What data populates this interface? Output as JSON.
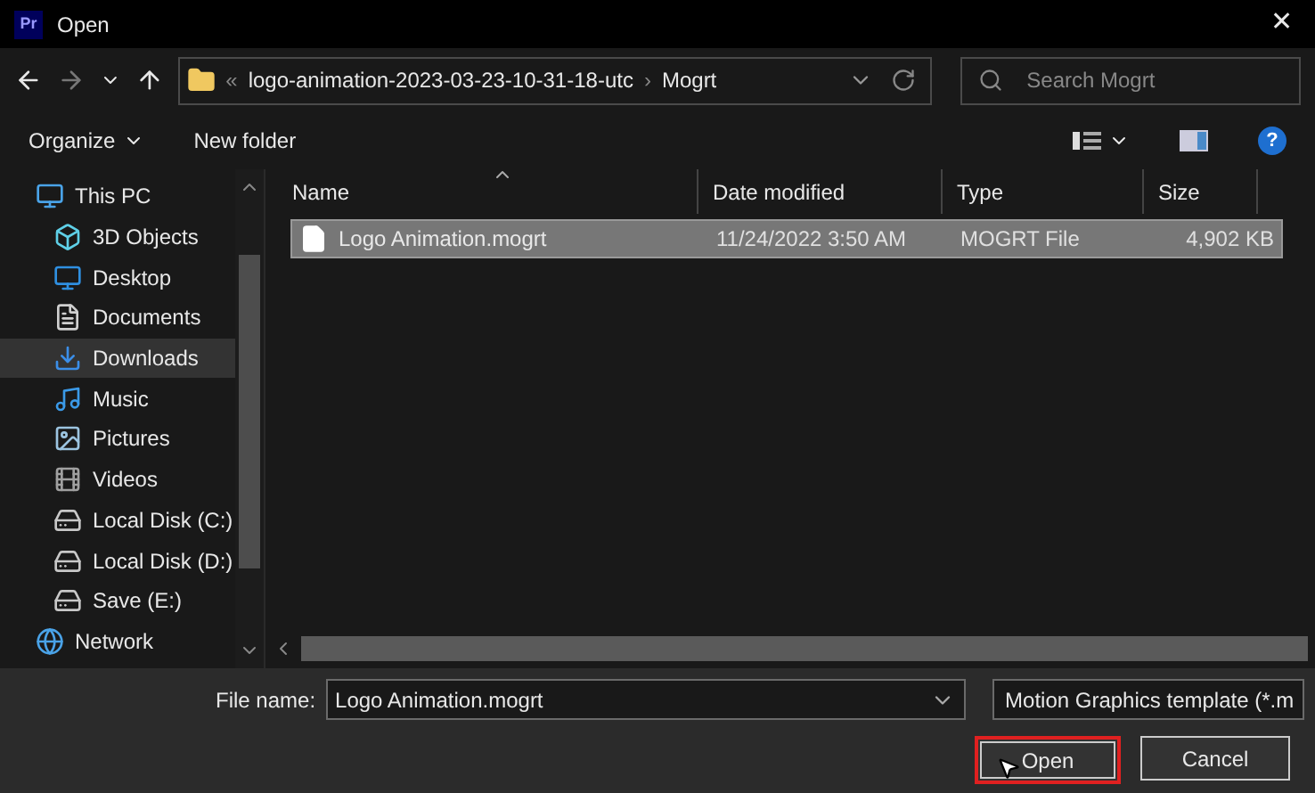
{
  "window": {
    "app_badge": "Pr",
    "title": "Open",
    "close": "✕"
  },
  "address": {
    "overflow": "«",
    "segments": [
      "logo-animation-2023-03-23-10-31-18-utc",
      "Mogrt"
    ],
    "separator": "›"
  },
  "search": {
    "placeholder": "Search Mogrt"
  },
  "toolbar": {
    "organize": "Organize",
    "new_folder": "New folder",
    "help": "?"
  },
  "sidebar": {
    "items": [
      {
        "label": "This PC",
        "selected": false,
        "children": [
          {
            "label": "3D Objects",
            "selected": false
          },
          {
            "label": "Desktop",
            "selected": false
          },
          {
            "label": "Documents",
            "selected": false
          },
          {
            "label": "Downloads",
            "selected": true
          },
          {
            "label": "Music",
            "selected": false
          },
          {
            "label": "Pictures",
            "selected": false
          },
          {
            "label": "Videos",
            "selected": false
          },
          {
            "label": "Local Disk (C:)",
            "selected": false
          },
          {
            "label": "Local Disk (D:)",
            "selected": false
          },
          {
            "label": "Save (E:)",
            "selected": false
          }
        ]
      },
      {
        "label": "Network",
        "selected": false
      }
    ]
  },
  "table": {
    "columns": [
      "Name",
      "Date modified",
      "Type",
      "Size"
    ],
    "rows": [
      {
        "name": "Logo Animation.mogrt",
        "date": "11/24/2022 3:50 AM",
        "type": "MOGRT File",
        "size": "4,902 KB",
        "selected": true
      }
    ]
  },
  "footer": {
    "file_name_label": "File name:",
    "file_name": "Logo Animation.mogrt",
    "file_type": "Motion Graphics template (*.m",
    "open": "Open",
    "cancel": "Cancel"
  }
}
